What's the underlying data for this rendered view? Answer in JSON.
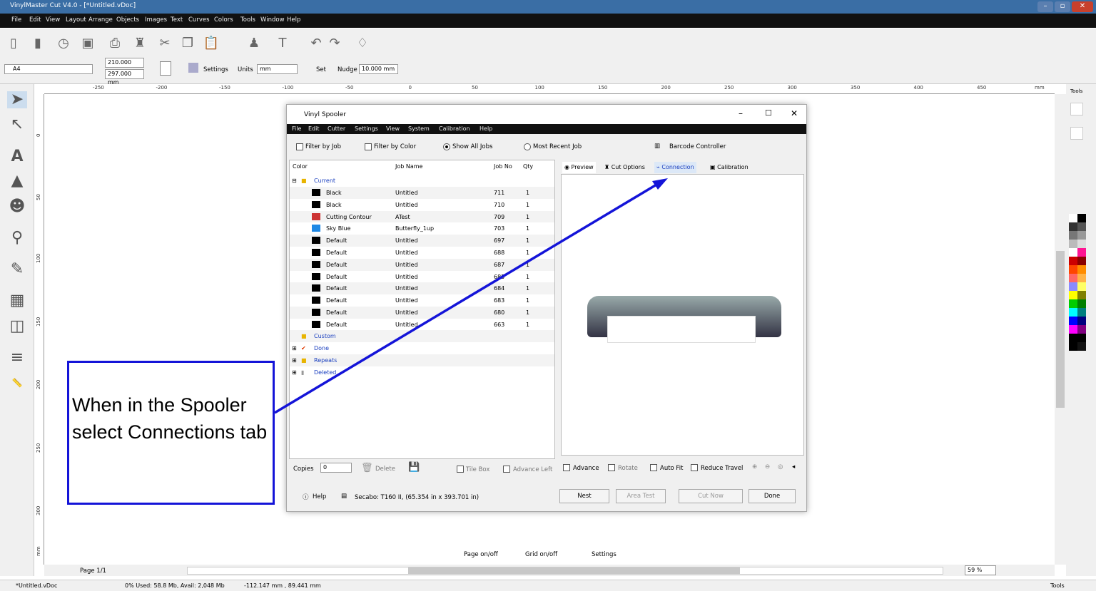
{
  "app": {
    "title": "VinylMaster Cut V4.0 - [*Untitled.vDoc]"
  },
  "menu": [
    "File",
    "Edit",
    "View",
    "Layout",
    "Arrange",
    "Objects",
    "Images",
    "Text",
    "Curves",
    "Colors",
    "Tools",
    "Window",
    "Help"
  ],
  "toolbar2": {
    "page_size": "A4",
    "width": "210.000 mm",
    "height": "297.000 mm",
    "settings": "Settings",
    "units_label": "Units",
    "units_value": "mm",
    "set": "Set",
    "nudge_label": "Nudge",
    "nudge_value": "10.000 mm"
  },
  "ruler": {
    "h_ticks": [
      "-250",
      "-200",
      "-150",
      "-100",
      "-50",
      "0",
      "50",
      "100",
      "150",
      "200",
      "250",
      "300",
      "350",
      "400",
      "450",
      "mm"
    ],
    "v_ticks": [
      "0",
      "50",
      "100",
      "150",
      "200",
      "250",
      "300",
      "mm"
    ]
  },
  "right_panel": {
    "tab": "Tools"
  },
  "spooler": {
    "title": "Vinyl Spooler",
    "menu": [
      "File",
      "Edit",
      "Cutter",
      "Settings",
      "View",
      "System",
      "Calibration",
      "Help"
    ],
    "filters": {
      "filter_job": "Filter by Job",
      "filter_color": "Filter by Color",
      "show_all": "Show All Jobs",
      "most_recent": "Most Recent Job",
      "barcode": "Barcode Controller"
    },
    "columns": {
      "color": "Color",
      "job_name": "Job Name",
      "job_no": "Job No",
      "qty": "Qty"
    },
    "groups": {
      "current": "Current",
      "custom": "Custom",
      "done": "Done",
      "repeats": "Repeats",
      "deleted": "Deleted"
    },
    "jobs": [
      {
        "color": "Black",
        "name": "Untitled",
        "no": "711",
        "qty": "1",
        "swatch": "#000000"
      },
      {
        "color": "Black",
        "name": "Untitled",
        "no": "710",
        "qty": "1",
        "swatch": "#000000"
      },
      {
        "color": "Cutting Contour",
        "name": "ATest",
        "no": "709",
        "qty": "1",
        "swatch": "#cc3333"
      },
      {
        "color": "Sky Blue",
        "name": "Butterfly_1up",
        "no": "703",
        "qty": "1",
        "swatch": "#1e88e5"
      },
      {
        "color": "Default",
        "name": "Untitled",
        "no": "697",
        "qty": "1",
        "swatch": "#000000"
      },
      {
        "color": "Default",
        "name": "Untitled",
        "no": "688",
        "qty": "1",
        "swatch": "#000000"
      },
      {
        "color": "Default",
        "name": "Untitled",
        "no": "687",
        "qty": "1",
        "swatch": "#000000"
      },
      {
        "color": "Default",
        "name": "Untitled",
        "no": "685",
        "qty": "1",
        "swatch": "#000000"
      },
      {
        "color": "Default",
        "name": "Untitled",
        "no": "684",
        "qty": "1",
        "swatch": "#000000"
      },
      {
        "color": "Default",
        "name": "Untitled",
        "no": "683",
        "qty": "1",
        "swatch": "#000000"
      },
      {
        "color": "Default",
        "name": "Untitled",
        "no": "680",
        "qty": "1",
        "swatch": "#000000"
      },
      {
        "color": "Default",
        "name": "Untitled",
        "no": "663",
        "qty": "1",
        "swatch": "#000000"
      }
    ],
    "tabs": {
      "preview": "Preview",
      "cut_options": "Cut Options",
      "connection": "Connection",
      "calibration": "Calibration"
    },
    "bottom_left": {
      "copies": "Copies",
      "copies_value": "0",
      "delete": "Delete",
      "tile_box": "Tile Box",
      "advance_left": "Advance Left"
    },
    "bottom_right": {
      "advance": "Advance",
      "rotate": "Rotate",
      "auto_fit": "Auto Fit",
      "reduce_travel": "Reduce Travel"
    },
    "footer": {
      "help": "Help",
      "cutter": "Secabo: T160 II,  (65.354 in x 393.701 in)",
      "nest": "Nest",
      "area_test": "Area Test",
      "cut_now": "Cut Now",
      "done": "Done"
    }
  },
  "callout": {
    "text": "When in the Spooler select Connections tab",
    "color": "#1414d8"
  },
  "bottom_bar": {
    "page": "Page 1/1",
    "page_onoff": "Page on/off",
    "grid_onoff": "Grid on/off",
    "settings": "Settings",
    "zoom": "59 %"
  },
  "status": {
    "doc": "*Untitled.vDoc",
    "memory": "0%  Used: 58.8 Mb, Avail: 2,048 Mb",
    "coords": "-112.147 mm , 89.441 mm",
    "tools": "Tools"
  },
  "palette": [
    "#ffffff",
    "#000000",
    "#333333",
    "#555555",
    "#777777",
    "#999999",
    "#bbbbbb",
    "#dddddd",
    "#ffffff",
    "#ff1493",
    "#cc0000",
    "#8b0000",
    "#ff4500",
    "#ff8c00",
    "#ff6666",
    "#ffb347",
    "#8a8aff",
    "#ffff66",
    "#ffff00",
    "#808000",
    "#00cc00",
    "#008000",
    "#00ffff",
    "#008080",
    "#0000ff",
    "#000080",
    "#ff00ff",
    "#800080",
    "#000000",
    "#000000",
    "#000000",
    "#111111"
  ]
}
